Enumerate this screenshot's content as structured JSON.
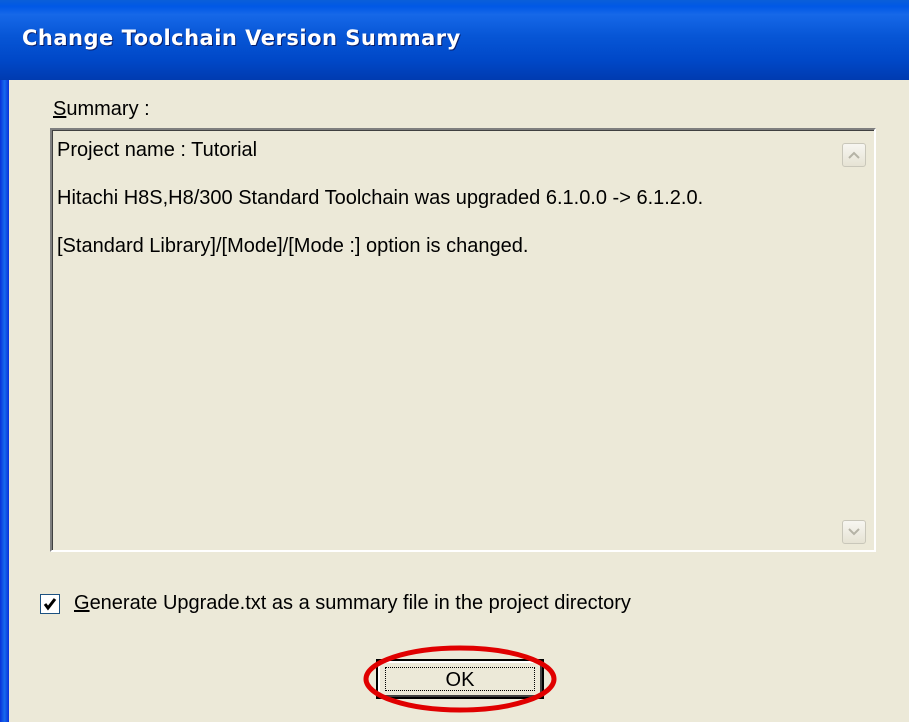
{
  "window": {
    "title": "Change Toolchain Version Summary"
  },
  "summary": {
    "label_first": "S",
    "label_rest": "ummary :",
    "lines": [
      "Project name : Tutorial",
      "Hitachi H8S,H8/300 Standard Toolchain was upgraded 6.1.0.0 -> 6.1.2.0.",
      "[Standard Library]/[Mode]/[Mode :] option is changed."
    ]
  },
  "generate_option": {
    "checked": true,
    "label_first": "G",
    "label_rest": "enerate Upgrade.txt as a summary file in the project directory"
  },
  "buttons": {
    "ok_label": "OK"
  },
  "colors": {
    "title_bar": "#0054e3",
    "dialog_face": "#ece9d8",
    "highlight_ring": "#e00000"
  }
}
